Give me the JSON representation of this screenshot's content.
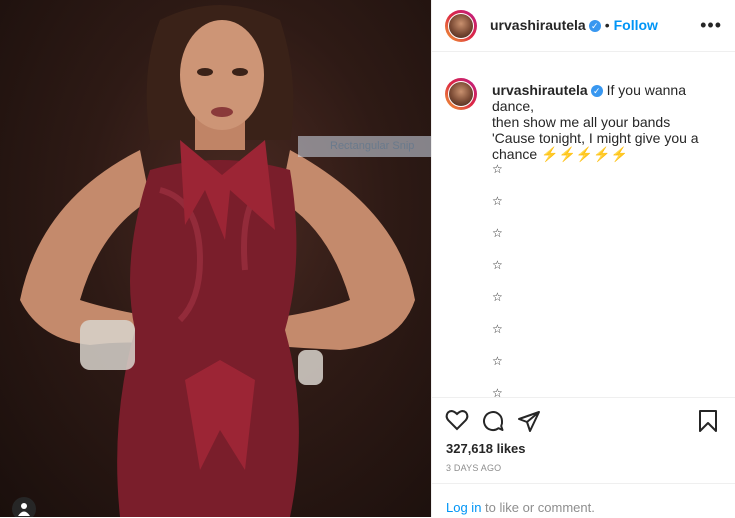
{
  "post": {
    "username": "urvashirautela",
    "follow_label": "Follow",
    "dot": "•",
    "more": "•••",
    "verified_glyph": "✓"
  },
  "caption": {
    "username": "urvashirautela",
    "line1": "If you wanna dance,",
    "line2": "then show me all your bands",
    "line3": "'Cause tonight, I might give you a",
    "line4": "chance ⚡⚡⚡⚡⚡",
    "stars": [
      "☆",
      "☆",
      "☆",
      "☆",
      "☆",
      "☆",
      "☆",
      "☆"
    ]
  },
  "overlay": {
    "snip_label": "Rectangular Snip"
  },
  "engagement": {
    "likes": "327,618 likes",
    "time_ago": "3 DAYS AGO"
  },
  "comment": {
    "login": "Log in",
    "rest": " to like or comment."
  },
  "icons": {
    "like": "heart-icon",
    "comment": "comment-icon",
    "share": "share-icon",
    "save": "bookmark-icon",
    "tag": "user-tag-icon"
  },
  "colors": {
    "accent": "#0095f6",
    "verified": "#3897f0",
    "dress": "#7a1e2b"
  }
}
